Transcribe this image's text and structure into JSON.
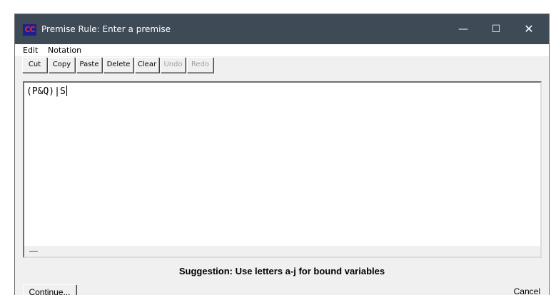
{
  "window": {
    "app_icon_text": "CC",
    "title": "Premise Rule: Enter a premise",
    "controls": {
      "minimize": "—",
      "maximize": "☐",
      "close": "✕"
    }
  },
  "menu": {
    "edit": "Edit",
    "notation": "Notation"
  },
  "toolbar": {
    "buttons": [
      {
        "label": "Cut",
        "enabled": true
      },
      {
        "label": "Copy",
        "enabled": true
      },
      {
        "label": "Paste",
        "enabled": true
      },
      {
        "label": "Delete",
        "enabled": true
      },
      {
        "label": "Clear",
        "enabled": true
      },
      {
        "label": "Undo",
        "enabled": false
      },
      {
        "label": "Redo",
        "enabled": false
      }
    ]
  },
  "editor": {
    "text": "(P&Q)|S"
  },
  "status": {
    "suggestion": "Suggestion: Use letters a-j for bound variables"
  },
  "buttons": {
    "continue": "Continue...",
    "cancel": "Cancel"
  },
  "colors": {
    "titlebar": "#3f4a57",
    "window_bg": "#f0f0f0",
    "disabled_text": "#a0a0a0"
  }
}
